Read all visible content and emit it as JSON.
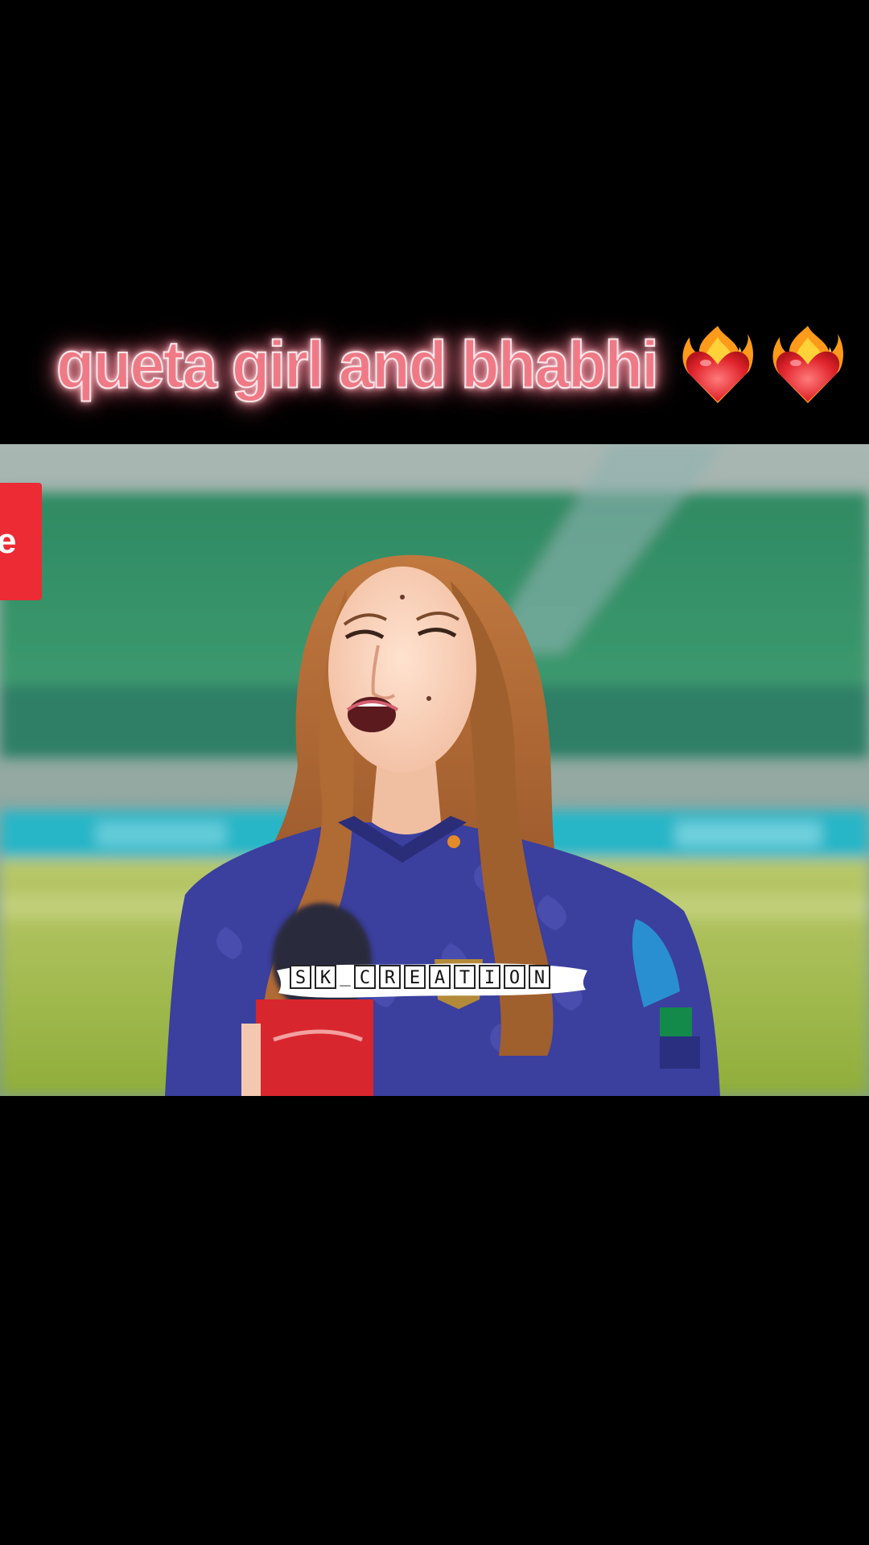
{
  "caption": {
    "text": "queta girl and bhabhi",
    "emojis": [
      "fire-heart-icon",
      "fire-heart-icon"
    ]
  },
  "side_tab": {
    "text": "e",
    "color": "#ec2b34"
  },
  "watermark": {
    "text": "SK_CREATION",
    "letters": [
      "S",
      "K",
      "_",
      "C",
      "R",
      "E",
      "A",
      "T",
      "I",
      "O",
      "N"
    ]
  },
  "colors": {
    "caption_fill": "#ef7a86",
    "caption_glow": "#ff9aa8",
    "jersey": "#3b3f9e",
    "background": "#000000"
  }
}
